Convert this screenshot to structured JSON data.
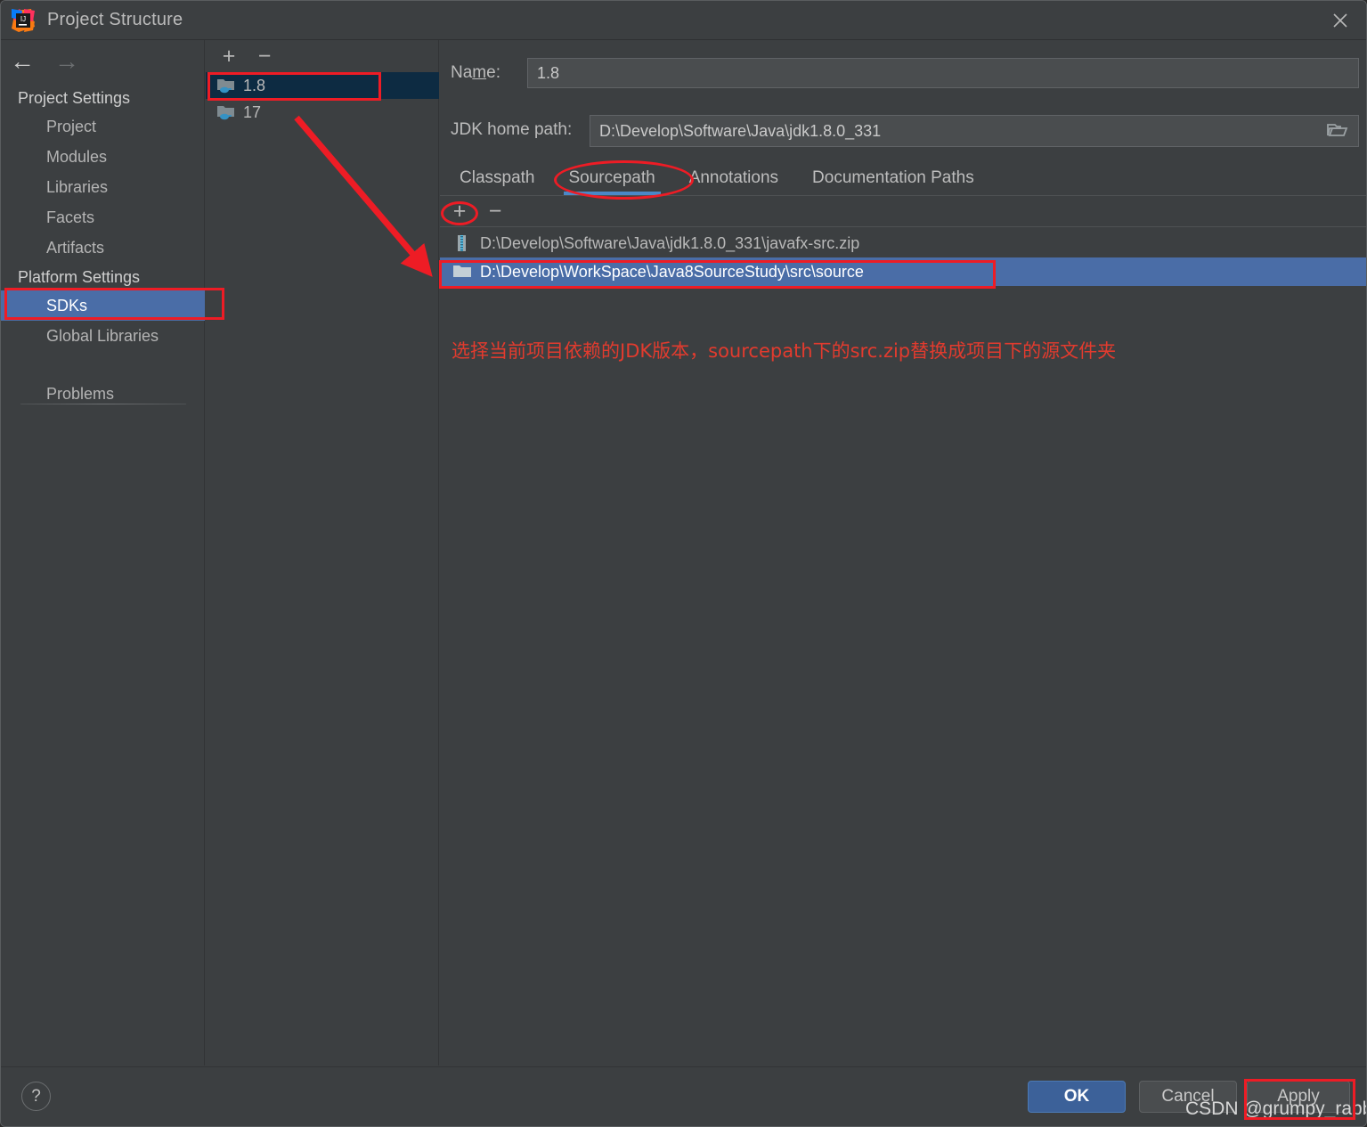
{
  "window": {
    "title": "Project Structure",
    "logo_icon": "intellij-idea-logo",
    "close_icon": "close-icon"
  },
  "sidebar": {
    "back_icon": "arrow-left-icon",
    "forward_icon": "arrow-right-icon",
    "groups": [
      {
        "header": "Project Settings",
        "items": [
          {
            "label": "Project",
            "selected": false
          },
          {
            "label": "Modules",
            "selected": false
          },
          {
            "label": "Libraries",
            "selected": false
          },
          {
            "label": "Facets",
            "selected": false
          },
          {
            "label": "Artifacts",
            "selected": false
          }
        ]
      },
      {
        "header": "Platform Settings",
        "items": [
          {
            "label": "SDKs",
            "selected": true
          },
          {
            "label": "Global Libraries",
            "selected": false
          }
        ]
      }
    ],
    "problems": "Problems"
  },
  "sdk_list": {
    "add_icon": "plus-icon",
    "remove_icon": "minus-icon",
    "add_label": "+",
    "remove_label": "−",
    "items": [
      {
        "label": "1.8",
        "icon": "jdk-folder-icon",
        "selected": true
      },
      {
        "label": "17",
        "icon": "jdk-folder-icon",
        "selected": false
      }
    ]
  },
  "main": {
    "name_label": "Name:",
    "name_mnemonic": "m",
    "name_value": "1.8",
    "jdk_home_label": "JDK home path:",
    "jdk_home_value": "D:\\Develop\\Software\\Java\\jdk1.8.0_331",
    "browse_icon": "folder-open-icon",
    "tabs": [
      {
        "label": "Classpath",
        "active": false
      },
      {
        "label": "Sourcepath",
        "active": true
      },
      {
        "label": "Annotations",
        "active": false
      },
      {
        "label": "Documentation Paths",
        "active": false
      }
    ],
    "path_toolbar": {
      "add_icon": "plus-icon",
      "remove_icon": "minus-icon",
      "add_label": "+",
      "remove_label": "−"
    },
    "paths": [
      {
        "label": "D:\\Develop\\Software\\Java\\jdk1.8.0_331\\javafx-src.zip",
        "icon": "zip-archive-icon",
        "selected": false
      },
      {
        "label": "D:\\Develop\\WorkSpace\\Java8SourceStudy\\src\\source",
        "icon": "folder-icon",
        "selected": true
      }
    ]
  },
  "annotation": {
    "note": "选择当前项目依赖的JDK版本，sourcepath下的src.zip替换成项目下的源文件夹",
    "color": "#e23b2e"
  },
  "footer": {
    "help_icon": "help-icon",
    "help_label": "?",
    "ok_label": "OK",
    "cancel_label": "Cancel",
    "apply_label": "Apply",
    "ok_color": "#3c6199"
  },
  "watermark": {
    "text": "CSDN @grumpy_rabbit"
  }
}
